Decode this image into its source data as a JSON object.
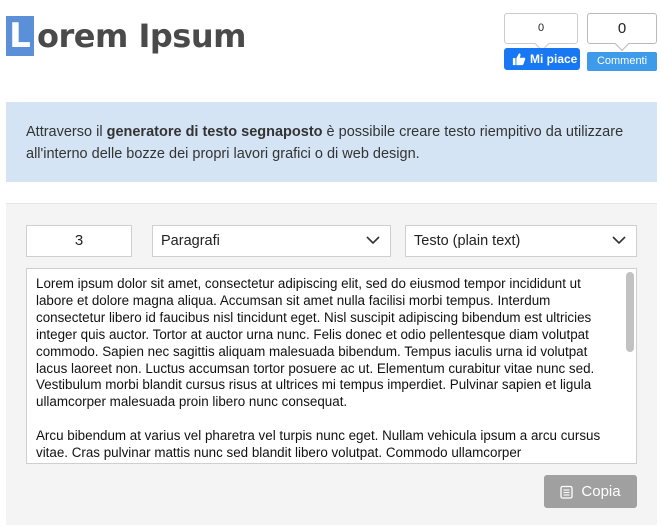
{
  "header": {
    "logo_letter": "L",
    "logo_rest": "orem Ipsum"
  },
  "social": {
    "like_count": "0",
    "like_label": "Mi piace",
    "comment_count": "0",
    "comment_label": "Commenti"
  },
  "info": {
    "text_before": "Attraverso il ",
    "text_bold": "generatore di testo segnaposto",
    "text_after": " è possibile creare testo riempitivo da utilizzare all'interno delle bozze dei propri lavori grafici o di web design."
  },
  "generator": {
    "count_value": "3",
    "type_selected": "Paragrafi",
    "format_selected": "Testo (plain text)",
    "paragraphs": [
      "Lorem ipsum dolor sit amet, consectetur adipiscing elit, sed do eiusmod tempor incididunt ut labore et dolore magna aliqua. Accumsan sit amet nulla facilisi morbi tempus. Interdum consectetur libero id faucibus nisl tincidunt eget. Nisl suscipit adipiscing bibendum est ultricies integer quis auctor. Tortor at auctor urna nunc. Felis donec et odio pellentesque diam volutpat commodo. Sapien nec sagittis aliquam malesuada bibendum. Tempus iaculis urna id volutpat lacus laoreet non. Luctus accumsan tortor posuere ac ut. Elementum curabitur vitae nunc sed. Vestibulum morbi blandit cursus risus at ultrices mi tempus imperdiet. Pulvinar sapien et ligula ullamcorper malesuada proin libero nunc consequat.",
      "Arcu bibendum at varius vel pharetra vel turpis nunc eget. Nullam vehicula ipsum a arcu cursus vitae. Cras pulvinar mattis nunc sed blandit libero volutpat. Commodo ullamcorper"
    ],
    "copy_label": "Copia"
  },
  "colors": {
    "logo_blue": "#5b8fd8",
    "info_bg": "#d4e4f4",
    "facebook_blue": "#1877f2",
    "comment_blue": "#3d9be9",
    "copy_button": "#a0a0a0"
  },
  "icons": {
    "like": "thumbs-up-icon",
    "copy": "clipboard-icon",
    "dropdown": "chevron-down-icon"
  }
}
